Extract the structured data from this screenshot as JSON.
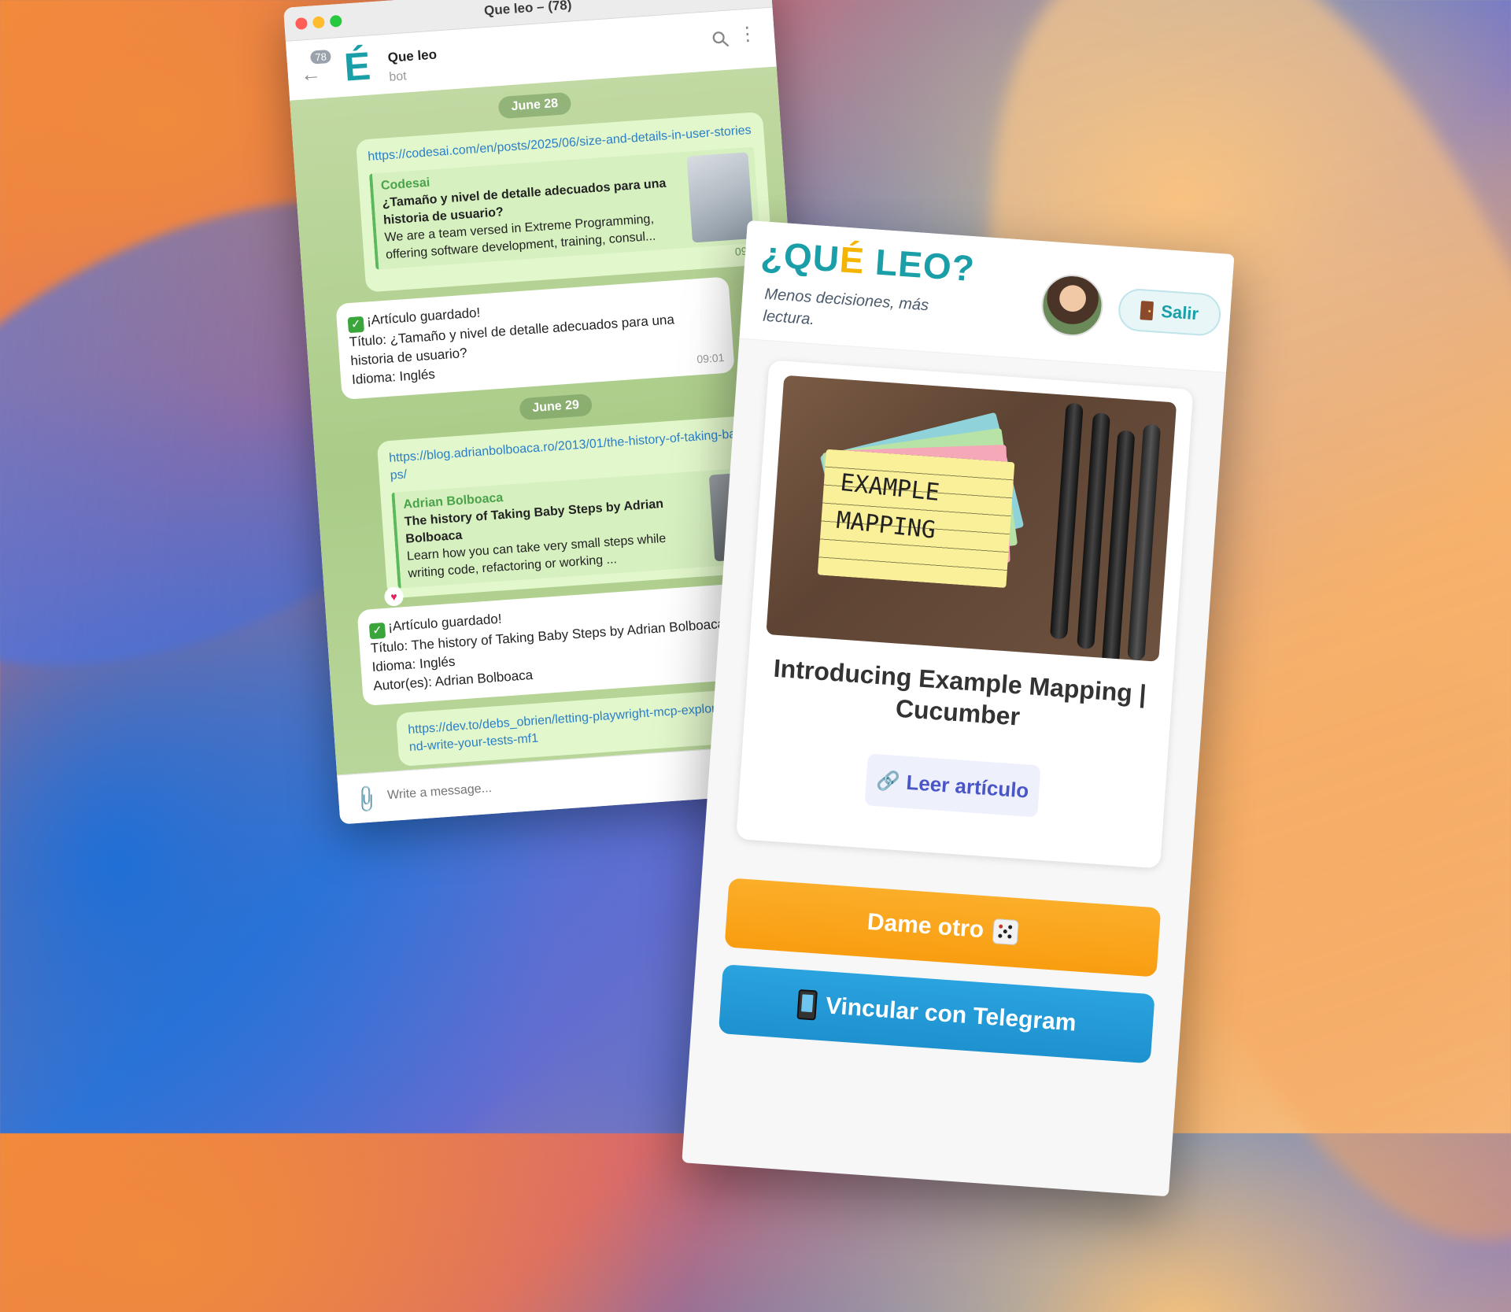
{
  "telegram": {
    "window_title": "Que leo – (78)",
    "unread_count": "78",
    "avatar_letter": "É",
    "chat_name": "Que leo",
    "chat_status": "bot",
    "compose_placeholder": "Write a message...",
    "messages": {
      "date1": "June 28",
      "m1": {
        "link": "https://codesai.com/en/posts/2025/06/size-and-details-in-user-stories",
        "site": "Codesai",
        "title": "¿Tamaño y nivel de detalle adecuados para una historia de usuario?",
        "desc": "We are a team versed in Extreme Programming, offering software development, training, consul...",
        "time": "09:00"
      },
      "m2": {
        "line1": "¡Artículo guardado!",
        "line2": "Título: ¿Tamaño y nivel de detalle adecuados para una historia de usuario?",
        "line3": "Idioma: Inglés",
        "time": "09:01"
      },
      "date2": "June 29",
      "m3": {
        "link": "https://blog.adrianbolboaca.ro/2013/01/the-history-of-taking-baby-steps/",
        "site": "Adrian Bolboaca",
        "title": "The history of Taking Baby Steps by Adrian Bolboaca",
        "desc": "Learn how you can take very small steps while writing code, refactoring or working ..."
      },
      "m4": {
        "line1": "¡Artículo guardado!",
        "line2": "Título: The history of Taking Baby Steps by Adrian Bolboaca",
        "line3": "Idioma: Inglés",
        "line4": "Autor(es): Adrian Bolboaca"
      },
      "m5": {
        "link": "https://dev.to/debs_obrien/letting-playwright-mcp-explore-your-site-and-write-your-tests-mf1"
      }
    }
  },
  "app": {
    "logo_part1": "¿QU",
    "logo_accent": "É",
    "logo_part2": " LEO?",
    "tagline": "Menos decisiones, más lectura.",
    "logout_label": "Salir",
    "sticky_line1": "EXAMPLE",
    "sticky_line2": "MAPPING",
    "article_title": "Introducing Example Mapping | Cucumber",
    "read_label": "Leer artículo",
    "another_label": "Dame otro",
    "telegram_label": "Vincular con Telegram"
  },
  "colors": {
    "brand_teal": "#1a9fa8",
    "accent_yellow": "#f5b400",
    "orange_button": "#f99d10",
    "telegram_blue": "#1e91cf"
  }
}
